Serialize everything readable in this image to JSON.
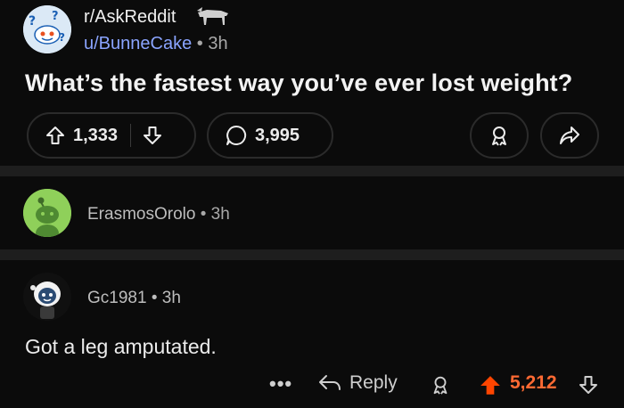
{
  "post": {
    "subreddit": "r/AskReddit",
    "user": "u/BunneCake",
    "separator": "•",
    "time": "3h",
    "title": "What’s the fastest way you’ve ever lost weight?",
    "upvotes": "1,333",
    "comments": "3,995"
  },
  "comments": [
    {
      "user": "ErasmosOrolo",
      "separator": "•",
      "time": "3h"
    },
    {
      "user": "Gc1981",
      "separator": "•",
      "time": "3h",
      "body": "Got a leg amputated.",
      "more": "•••",
      "reply_label": "Reply",
      "score": "5,212"
    }
  ],
  "colors": {
    "background": "#0b0b0b",
    "divider": "#1e1e1e",
    "username": "#8aa4ff",
    "upvoted": "#ff6a33",
    "text": "#e8e8e8"
  },
  "icons": [
    "subreddit-avatar",
    "flair-icon",
    "upvote-icon",
    "downvote-icon",
    "comment-icon",
    "award-icon",
    "share-icon",
    "snoo-avatar",
    "user-avatar",
    "reply-icon"
  ]
}
